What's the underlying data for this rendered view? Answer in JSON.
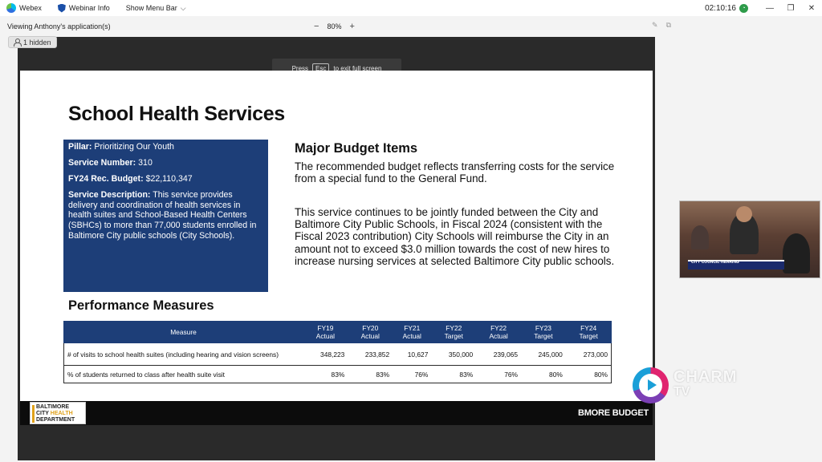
{
  "titlebar": {
    "app_name": "Webex",
    "webinar_info": "Webinar Info",
    "show_menu_bar": "Show Menu Bar",
    "clock": "02:10:16"
  },
  "subbar": {
    "viewing": "Viewing Anthony's application(s)",
    "zoom_level": "80%",
    "hidden_count": "1 hidden"
  },
  "share": {
    "esc_press": "Press",
    "esc_key": "Esc",
    "esc_suffix": "to exit full screen"
  },
  "slide": {
    "title": "School Health Services",
    "info": {
      "pillar_label": "Pillar:",
      "pillar_value": "Prioritizing Our Youth",
      "service_number_label": "Service Number:",
      "service_number_value": "310",
      "budget_label": "FY24 Rec. Budget:",
      "budget_value": "$22,110,347",
      "description_label": "Service Description:",
      "description_value": "This service provides delivery and coordination of health services in health suites and School-Based Health Centers (SBHCs) to more than 77,000 students enrolled in Baltimore City public schools (City Schools)."
    },
    "major_budget": {
      "title": "Major Budget Items",
      "paragraph1": "The recommended budget reflects transferring costs for the service from a special fund to the General Fund.",
      "paragraph2": "This service continues to be jointly funded between the City and Baltimore City Public Schools, in Fiscal 2024 (consistent with the Fiscal 2023 contribution) City Schools will reimburse the City in an amount not to exceed $3.0 million towards the cost of new hires to increase nursing services at selected Baltimore City public schools."
    },
    "performance": {
      "title": "Performance Measures",
      "headers": [
        {
          "l1": "Measure",
          "l2": ""
        },
        {
          "l1": "FY19",
          "l2": "Actual"
        },
        {
          "l1": "FY20",
          "l2": "Actual"
        },
        {
          "l1": "FY21",
          "l2": "Actual"
        },
        {
          "l1": "FY22",
          "l2": "Target"
        },
        {
          "l1": "FY22",
          "l2": "Actual"
        },
        {
          "l1": "FY23",
          "l2": "Target"
        },
        {
          "l1": "FY24",
          "l2": "Target"
        }
      ],
      "rows": [
        [
          "# of visits to school health suites (including hearing and vision screens)",
          "348,223",
          "233,852",
          "10,627",
          "350,000",
          "239,065",
          "245,000",
          "273,000"
        ],
        [
          "% of students returned to class after health suite visit",
          "83%",
          "83%",
          "76%",
          "83%",
          "76%",
          "80%",
          "80%"
        ]
      ]
    },
    "footer": {
      "logo_line1": "BALTIMORE",
      "logo_line2a": "CITY",
      "logo_line2b": "HEALTH",
      "logo_line3": "DEPARTMENT",
      "bmore": "BMORE BUDGET"
    }
  },
  "camera": {
    "lower_third": "CITY COUNCIL HEARING"
  },
  "watermark": {
    "charm": "CHARM",
    "tv": "TV"
  },
  "colors": {
    "slide_navy": "#1d3e78",
    "footer_gold": "#e0a21b"
  }
}
